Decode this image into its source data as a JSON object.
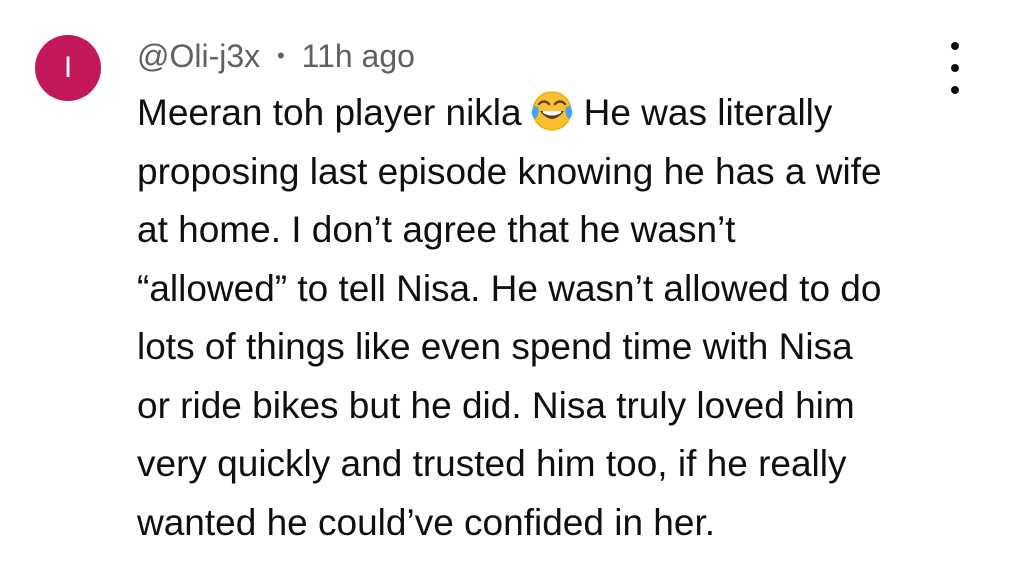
{
  "comment": {
    "avatar": {
      "initial": "I",
      "color": "#c2185b"
    },
    "author": "@Oli-j3x",
    "separator": "•",
    "time": "11h ago",
    "emoji": "face-with-tears-of-joy",
    "text_lines": [
      {
        "before": "Meeran toh player nikla",
        "after": "He was literally"
      },
      "proposing last episode knowing he has a wife",
      "at home. I don’t agree that he wasn’t",
      "“allowed” to tell Nisa. He wasn’t allowed to do",
      "lots of things like even spend time with Nisa",
      "or ride bikes but he did. Nisa truly loved him",
      "very quickly and trusted him too, if he really",
      "wanted he could’ve confided in her."
    ],
    "menu_icon": "more-vertical-icon"
  }
}
